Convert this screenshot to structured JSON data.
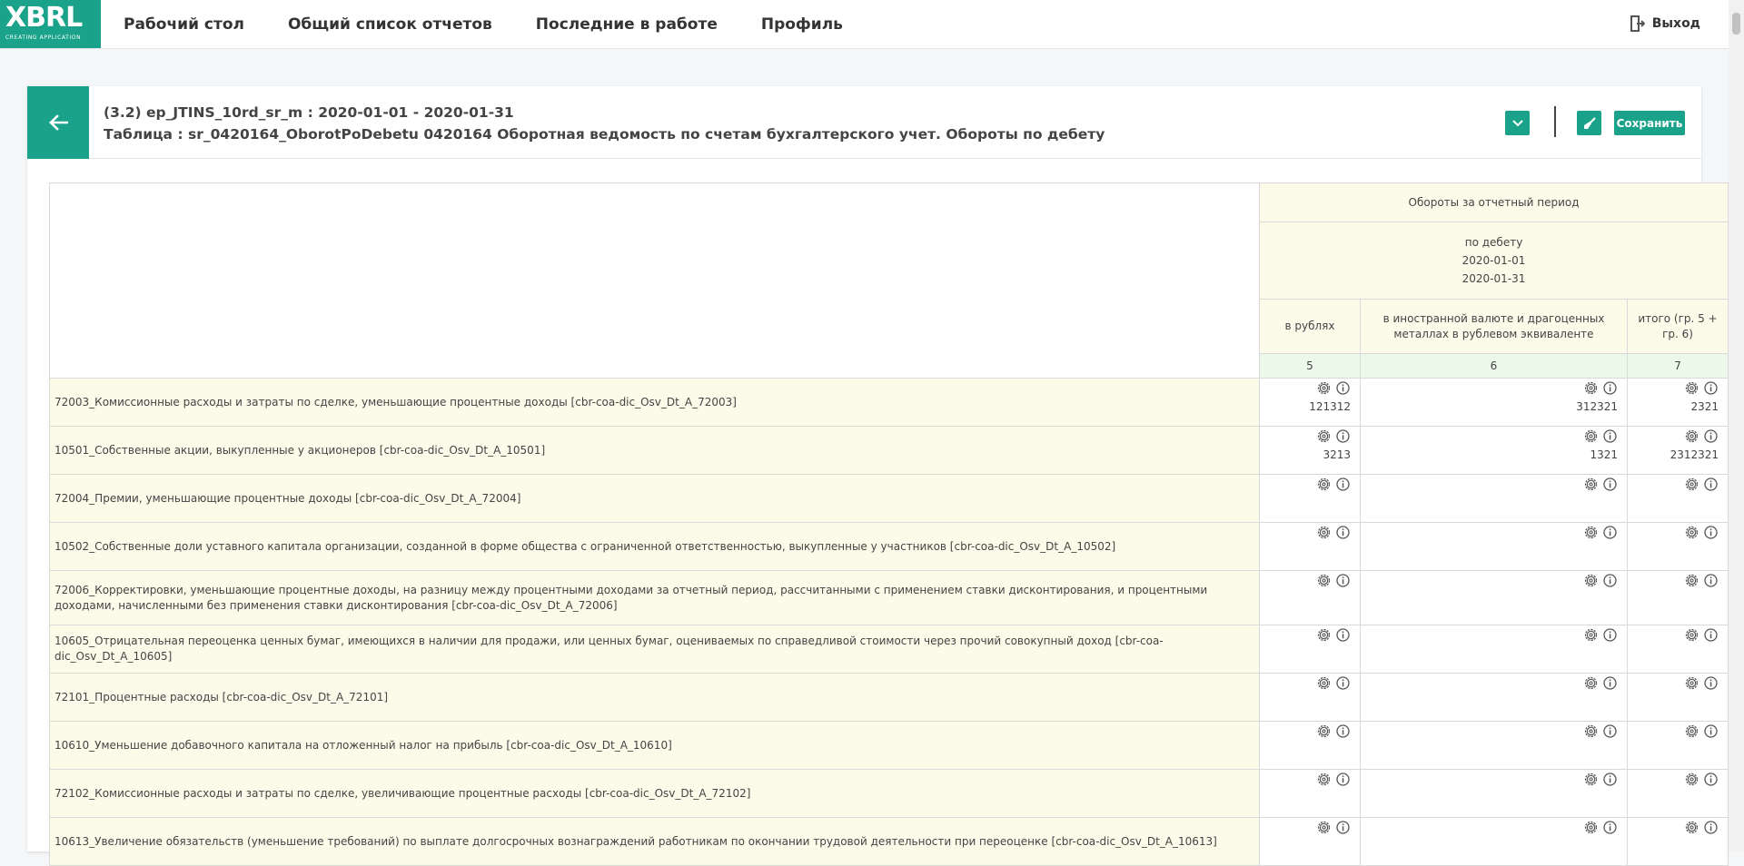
{
  "logo": {
    "text": "XBRL",
    "subtitle": "CREATING APPLICATION"
  },
  "nav": [
    {
      "label": "Рабочий стол"
    },
    {
      "label": "Общий список отчетов"
    },
    {
      "label": "Последние в работе"
    },
    {
      "label": "Профиль"
    }
  ],
  "logout_label": "Выход",
  "header": {
    "title_line1": "(3.2) ep_JTINS_10rd_sr_m : 2020-01-01 - 2020-01-31",
    "title_line2": "Таблица : sr_0420164_OborotPoDebetu 0420164 Оборотная ведомость по счетам бухгалтерского учет. Обороты по дебету",
    "save_label": "Сохранить"
  },
  "colors": {
    "accent": "#1aa38a",
    "header_bg": "#fcfbea",
    "num_bg": "#ebf8ea"
  },
  "icons": [
    "back-arrow-icon",
    "chevron-down-icon",
    "broom-icon",
    "settings-icon",
    "info-icon",
    "logout-icon"
  ],
  "table": {
    "group_header": "Обороты за отчетный период",
    "sub_header": {
      "title": "по дебету",
      "date_from": "2020-01-01",
      "date_to": "2020-01-31"
    },
    "columns": [
      {
        "label": "в рублях",
        "num": "5"
      },
      {
        "label": "в иностранной валюте и драгоценных металлах в рублевом эквиваленте",
        "num": "6"
      },
      {
        "label": "итого (гр. 5 + гр. 6)",
        "num": "7"
      }
    ],
    "rows": [
      {
        "label": "72003_Комиссионные расходы и затраты по сделке, уменьшающие процентные доходы [cbr-coa-dic_Osv_Dt_A_72003]",
        "values": [
          "121312",
          "312321",
          "2321"
        ]
      },
      {
        "label": "10501_Собственные акции, выкупленные у акционеров [cbr-coa-dic_Osv_Dt_A_10501]",
        "values": [
          "3213",
          "1321",
          "2312321"
        ]
      },
      {
        "label": "72004_Премии, уменьшающие процентные доходы [cbr-coa-dic_Osv_Dt_A_72004]",
        "values": [
          "",
          "",
          ""
        ]
      },
      {
        "label": "10502_Собственные доли уставного капитала организации, созданной в форме общества с ограниченной ответственностью, выкупленные у участников [cbr-coa-dic_Osv_Dt_A_10502]",
        "values": [
          "",
          "",
          ""
        ]
      },
      {
        "label": "72006_Корректировки, уменьшающие процентные доходы, на разницу между процентными доходами за отчетный период, рассчитанными с применением ставки дисконтирования, и процентными доходами, начисленными без применения ставки дисконтирования [cbr-coa-dic_Osv_Dt_A_72006]",
        "values": [
          "",
          "",
          ""
        ]
      },
      {
        "label": "10605_Отрицательная переоценка ценных бумаг, имеющихся в наличии для продажи, или ценных бумаг, оцениваемых по справедливой стоимости через прочий совокупный доход [cbr-coa-dic_Osv_Dt_A_10605]",
        "values": [
          "",
          "",
          ""
        ]
      },
      {
        "label": "72101_Процентные расходы [cbr-coa-dic_Osv_Dt_A_72101]",
        "values": [
          "",
          "",
          ""
        ]
      },
      {
        "label": "10610_Уменьшение добавочного капитала на отложенный налог на прибыль [cbr-coa-dic_Osv_Dt_A_10610]",
        "values": [
          "",
          "",
          ""
        ]
      },
      {
        "label": "72102_Комиссионные расходы и затраты по сделке, увеличивающие процентные расходы [cbr-coa-dic_Osv_Dt_A_72102]",
        "values": [
          "",
          "",
          ""
        ]
      },
      {
        "label": "10613_Увеличение обязательств (уменьшение требований) по выплате долгосрочных вознаграждений работникам по окончании трудовой деятельности при переоценке [cbr-coa-dic_Osv_Dt_A_10613]",
        "values": [
          "",
          "",
          ""
        ]
      }
    ]
  }
}
